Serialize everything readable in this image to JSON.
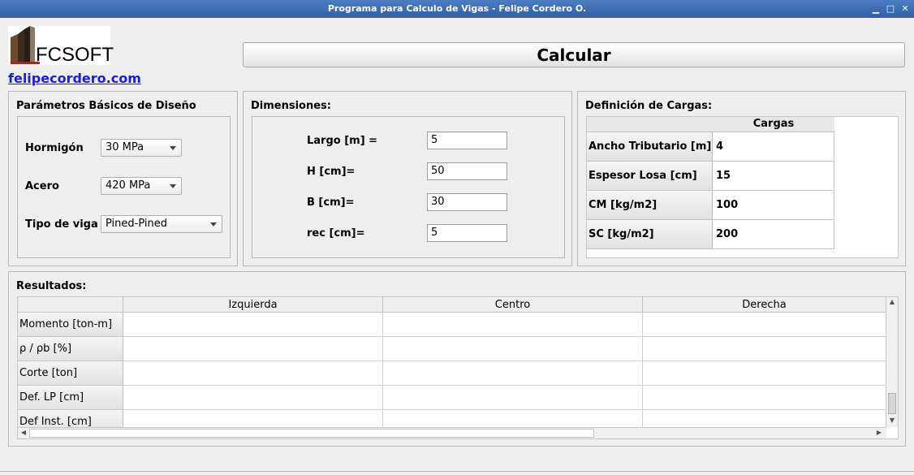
{
  "window": {
    "title": "Programa para Calculo de Vigas - Felipe Cordero O."
  },
  "logo": {
    "text": "FCSOFT"
  },
  "link": {
    "text": "felipecordero.com"
  },
  "toolbar": {
    "calc_label": "Calcular"
  },
  "basic": {
    "title": "Parámetros Básicos de Diseño",
    "hormigon_label": "Hormigón",
    "hormigon_value": "30 MPa",
    "acero_label": "Acero",
    "acero_value": "420 MPa",
    "tipo_label": "Tipo de viga",
    "tipo_value": "Pined-Pined"
  },
  "dims": {
    "title": "Dimensiones:",
    "largo_label": "Largo [m] =",
    "largo_value": "5",
    "h_label": "H [cm]=",
    "h_value": "50",
    "b_label": "B [cm]=",
    "b_value": "30",
    "rec_label": "rec [cm]=",
    "rec_value": "5"
  },
  "loads": {
    "title": "Definición de Cargas:",
    "column": "Cargas",
    "rows": [
      {
        "label": "Ancho Tributario [m]",
        "value": "4"
      },
      {
        "label": "Espesor Losa [cm]",
        "value": "15"
      },
      {
        "label": "CM [kg/m2]",
        "value": "100"
      },
      {
        "label": "SC [kg/m2]",
        "value": "200"
      }
    ]
  },
  "results": {
    "title": "Resultados:",
    "columns": [
      "Izquierda",
      "Centro",
      "Derecha"
    ],
    "rows": [
      "Momento [ton-m]",
      " ρ / ρb [%]",
      "Corte [ton]",
      "Def. LP [cm]",
      "Def Inst. [cm]"
    ]
  },
  "icons": {
    "minimize": "minimize-icon",
    "maximize": "maximize-icon",
    "close": "close-icon"
  },
  "colors": {
    "titlebar": "#3a6bb5",
    "link": "#1a1aee"
  }
}
